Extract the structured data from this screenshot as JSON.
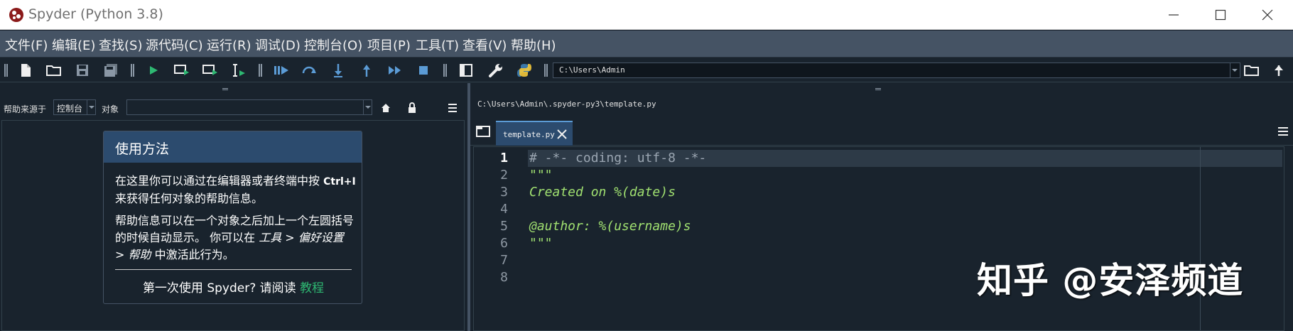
{
  "window": {
    "title": "Spyder (Python 3.8)"
  },
  "menu": [
    "文件(F)",
    "编辑(E)",
    "查找(S)",
    "源代码(C)",
    "运行(R)",
    "调试(D)",
    "控制台(O)",
    "项目(P)",
    "工具(T)",
    "查看(V)",
    "帮助(H)"
  ],
  "toolbar": {
    "path": "C:\\Users\\Admin"
  },
  "help": {
    "source_label": "帮助来源于",
    "source_value": "控制台",
    "object_label": "对象",
    "object_value": "",
    "card_title": "使用方法",
    "para1_a": "在这里你可以通过在编辑器或者终端中按",
    "para1_key": "Ctrl+I",
    "para1_b": "来获得任何对象的帮助信息。",
    "para2_a": "帮助信息可以在一个对象之后加上一个左圆括号的时候自动显示。 你可以在",
    "para2_menu": "工具 > 偏好设置 > 帮助",
    "para2_b": "中激活此行为。",
    "first_use": "第一次使用 Spyder? 请阅读",
    "tutorial_link": "教程"
  },
  "editor": {
    "file_path": "C:\\Users\\Admin\\.spyder-py3\\template.py",
    "tab_name": "template.py",
    "line_numbers": [
      "1",
      "2",
      "3",
      "4",
      "5",
      "6",
      "7",
      "8"
    ],
    "lines": [
      "# -*- coding: utf-8 -*-",
      "\"\"\"",
      "Created on %(date)s",
      "",
      "@author: %(username)s",
      "\"\"\"",
      "",
      ""
    ],
    "current_line": 1
  },
  "watermark": "知乎 @安泽频道",
  "colors": {
    "menubar": "#455364",
    "background": "#19232d",
    "header": "#2c4b6e",
    "link": "#2eb872",
    "string": "#a0e070"
  }
}
